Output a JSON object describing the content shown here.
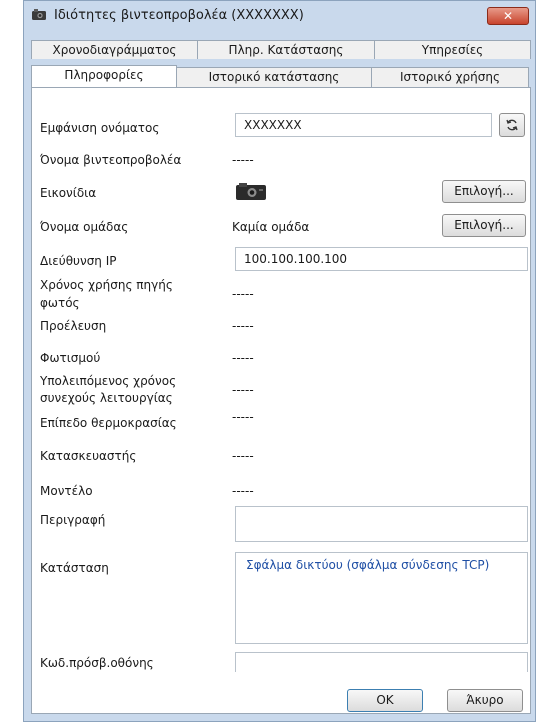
{
  "window": {
    "title": "Ιδιότητες βιντεοπροβολέα (XXXXXXX)",
    "close_glyph": "✕"
  },
  "tabs_top": [
    "Χρονοδιαγράμματος",
    "Πληρ. Κατάστασης",
    "Υπηρεσίες"
  ],
  "tabs_bottom": [
    "Πληροφορίες",
    "Ιστορικό κατάστασης",
    "Ιστορικό χρήσης"
  ],
  "active_tab": "Πληροφορίες",
  "fields": {
    "display_name_label": "Εμφάνιση ονόματος",
    "display_name_value": "XXXXXXX",
    "projector_name_label": "Όνομα βιντεοπροβολέα",
    "projector_name_value": "-----",
    "icon_label": "Εικονίδια",
    "icon_select_button": "Επιλογή...",
    "group_name_label": "Όνομα ομάδας",
    "group_name_value": "Καμία ομάδα",
    "group_select_button": "Επιλογή...",
    "ip_label": "Διεύθυνση IP",
    "ip_value": "100.100.100.100",
    "lamp_hours_label_1": "Χρόνος χρήσης πηγής",
    "lamp_hours_label_2": "φωτός",
    "lamp_hours_value": "-----",
    "source_label": "Προέλευση",
    "source_value": "-----",
    "lighting_label": "Φωτισμού",
    "lighting_value": "-----",
    "remaining_label_1": "Υπολειπόμενος χρόνος",
    "remaining_label_2": "συνεχούς λειτουργίας",
    "remaining_value": "-----",
    "temperature_label": "Επίπεδο θερμοκρασίας",
    "temperature_value": "-----",
    "manufacturer_label": "Κατασκευαστής",
    "manufacturer_value": "-----",
    "model_label": "Μοντέλο",
    "model_value": "-----",
    "description_label": "Περιγραφή",
    "description_value": "",
    "status_label": "Κατάσταση",
    "status_value": "Σφάλμα δικτύου (σφάλμα σύνδεσης TCP)",
    "screen_code_label": "Κωδ.πρόσβ.οθόνης",
    "screen_code_value": ""
  },
  "footer": {
    "ok": "OK",
    "cancel": "Άκυρο"
  }
}
